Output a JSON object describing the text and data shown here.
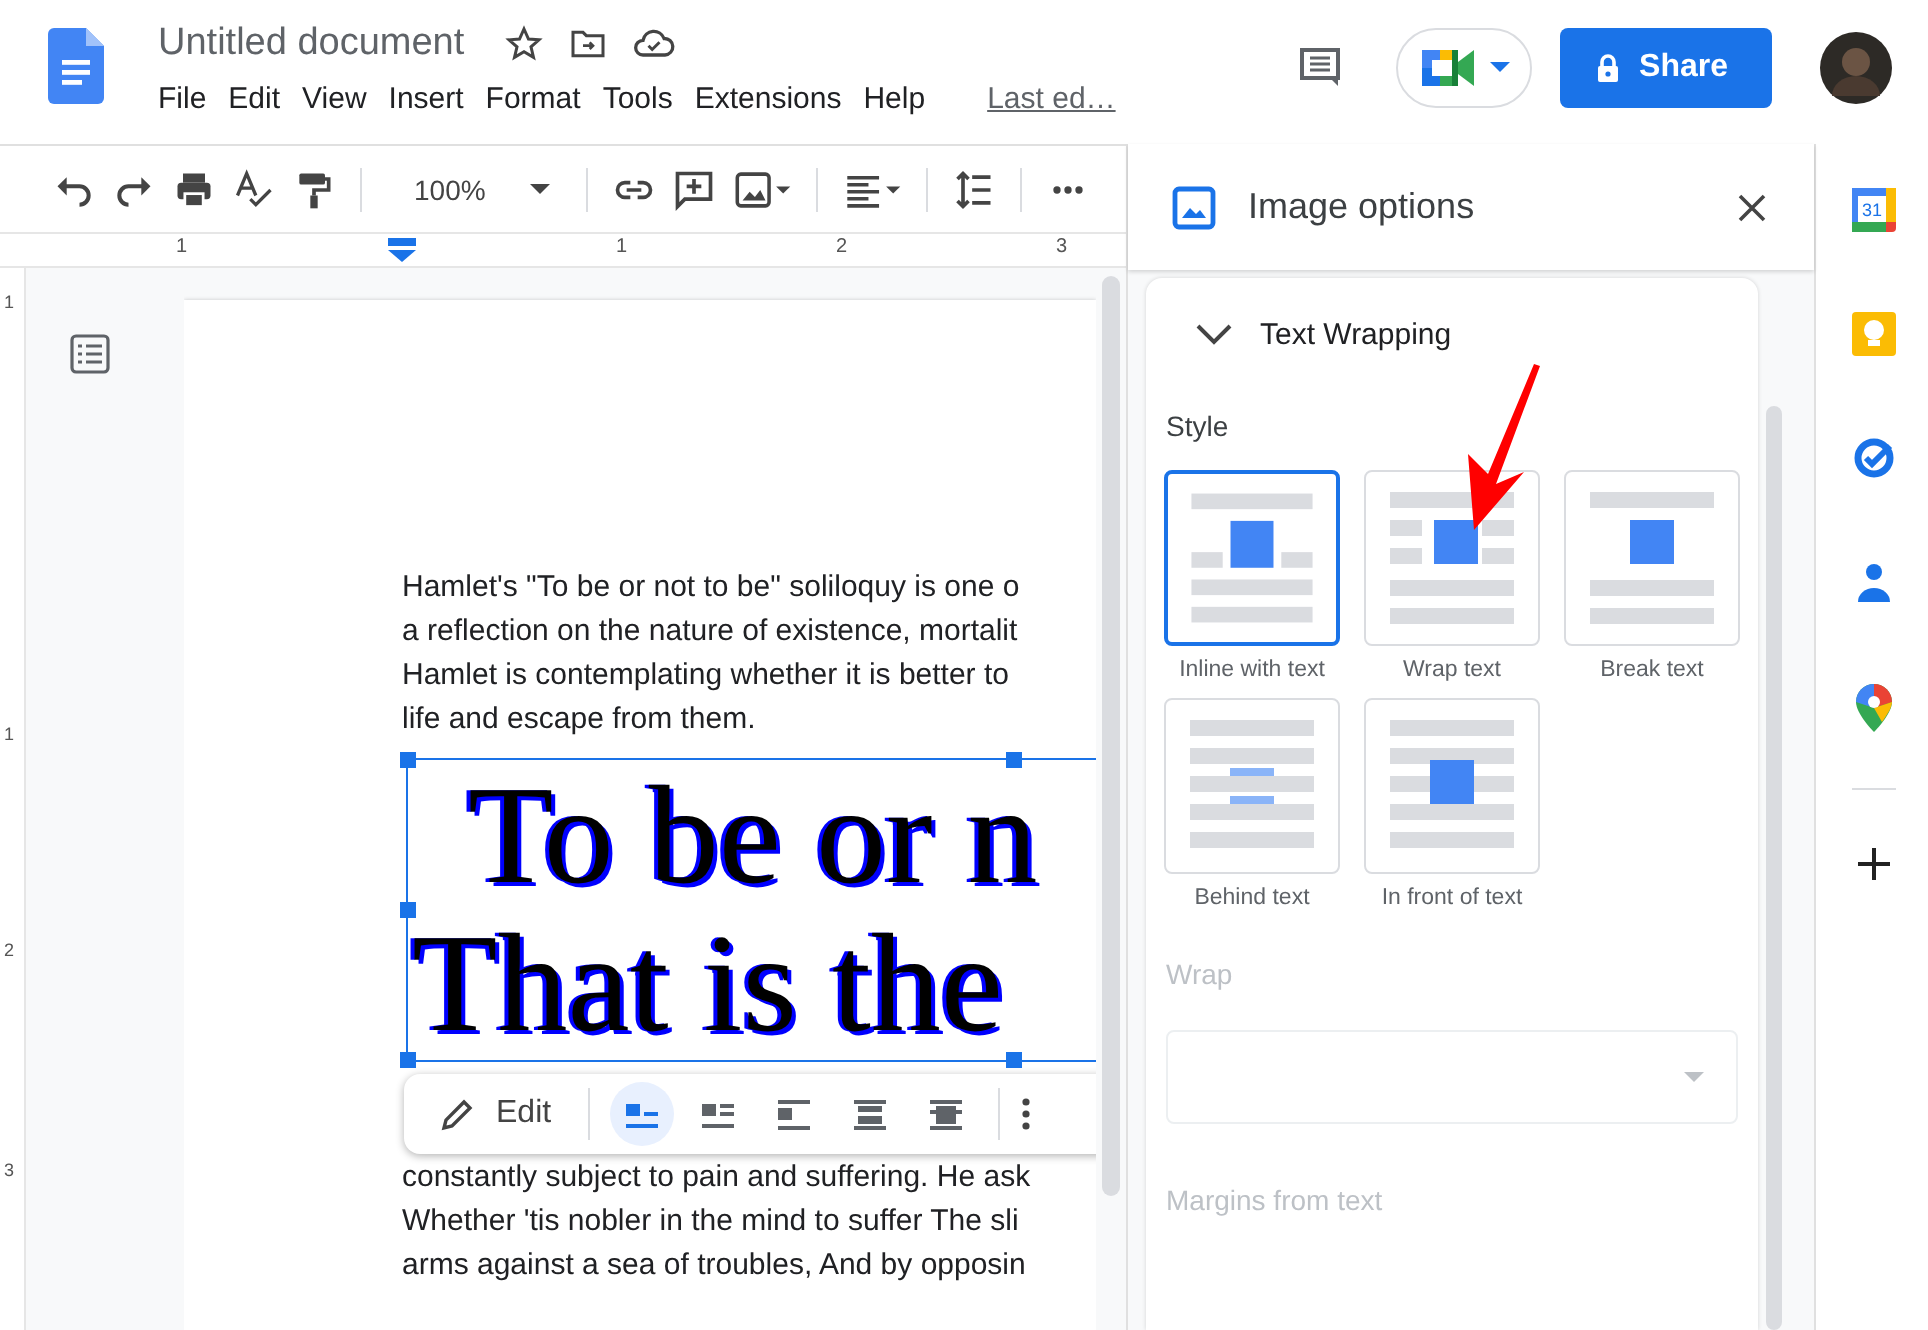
{
  "document": {
    "title": "Untitled document",
    "menus": [
      "File",
      "Edit",
      "View",
      "Insert",
      "Format",
      "Tools",
      "Extensions",
      "Help"
    ],
    "last_edit": "Last ed…",
    "share": "Share"
  },
  "toolbar": {
    "zoom": "100%"
  },
  "ruler": {
    "marks": [
      "1",
      "1",
      "2",
      "3"
    ],
    "vertical_marks": [
      "1",
      "1",
      "2",
      "3"
    ]
  },
  "page": {
    "lines_top": [
      "Hamlet's \"To be or not to be\" soliloquy is one o",
      "a reflection on the nature of existence, mortalit",
      "Hamlet is contemplating whether it is better to",
      "life and escape from them."
    ],
    "image_lines": [
      "To be or n",
      "That is the"
    ],
    "edit": "Edit",
    "wrap_modes": [
      {
        "kind": "inline",
        "selected": true
      },
      {
        "kind": "wrap",
        "selected": false
      },
      {
        "kind": "break",
        "selected": false
      },
      {
        "kind": "behind",
        "selected": false
      },
      {
        "kind": "front",
        "selected": false
      }
    ],
    "lines_bottom": [
      "constantly subject to pain and suffering. He ask",
      "Whether 'tis nobler in the mind to suffer The sli",
      "arms against a sea of troubles, And by opposin"
    ]
  },
  "panel": {
    "title": "Image options",
    "section": {
      "title": "Text Wrapping",
      "expanded": true
    },
    "style_label": "Style",
    "styles": [
      {
        "label": "Inline with text",
        "kind": "inline",
        "selected": true
      },
      {
        "label": "Wrap text",
        "kind": "wrap",
        "selected": false
      },
      {
        "label": "Break text",
        "kind": "break",
        "selected": false
      },
      {
        "label": "Behind text",
        "kind": "behind",
        "selected": false
      },
      {
        "label": "In front of text",
        "kind": "front",
        "selected": false
      }
    ],
    "wrap": {
      "label": "Wrap",
      "disabled": true
    },
    "margins": {
      "label": "Margins from text",
      "disabled": true
    }
  },
  "rail": {
    "calendar_day": "31"
  }
}
